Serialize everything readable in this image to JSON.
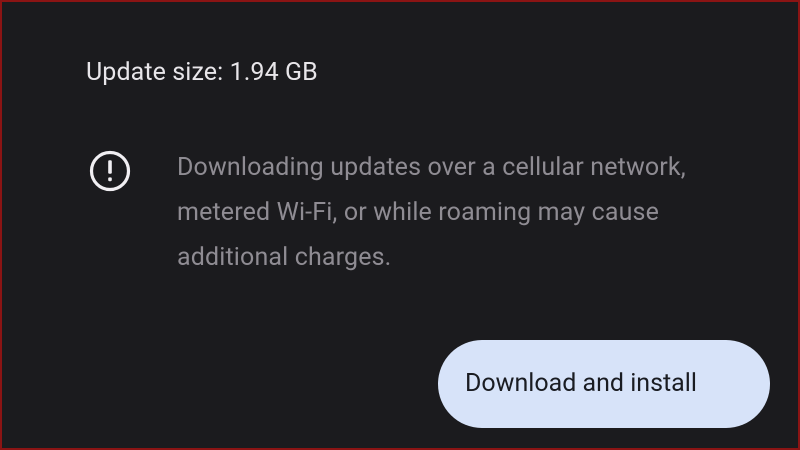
{
  "update": {
    "size_label": "Update size: 1.94 GB"
  },
  "warning": {
    "icon": "exclamation-circle-icon",
    "message": "Downloading updates over a cellular network, metered Wi-Fi, or while roaming may cause additional charges."
  },
  "actions": {
    "primary_label": "Download and install"
  },
  "colors": {
    "background": "#1b1b1e",
    "primary_text": "#e8e6ea",
    "secondary_text": "#8f8c93",
    "button_background": "#d7e3f9",
    "button_text": "#1a1c22",
    "frame_border": "#8b1414"
  }
}
